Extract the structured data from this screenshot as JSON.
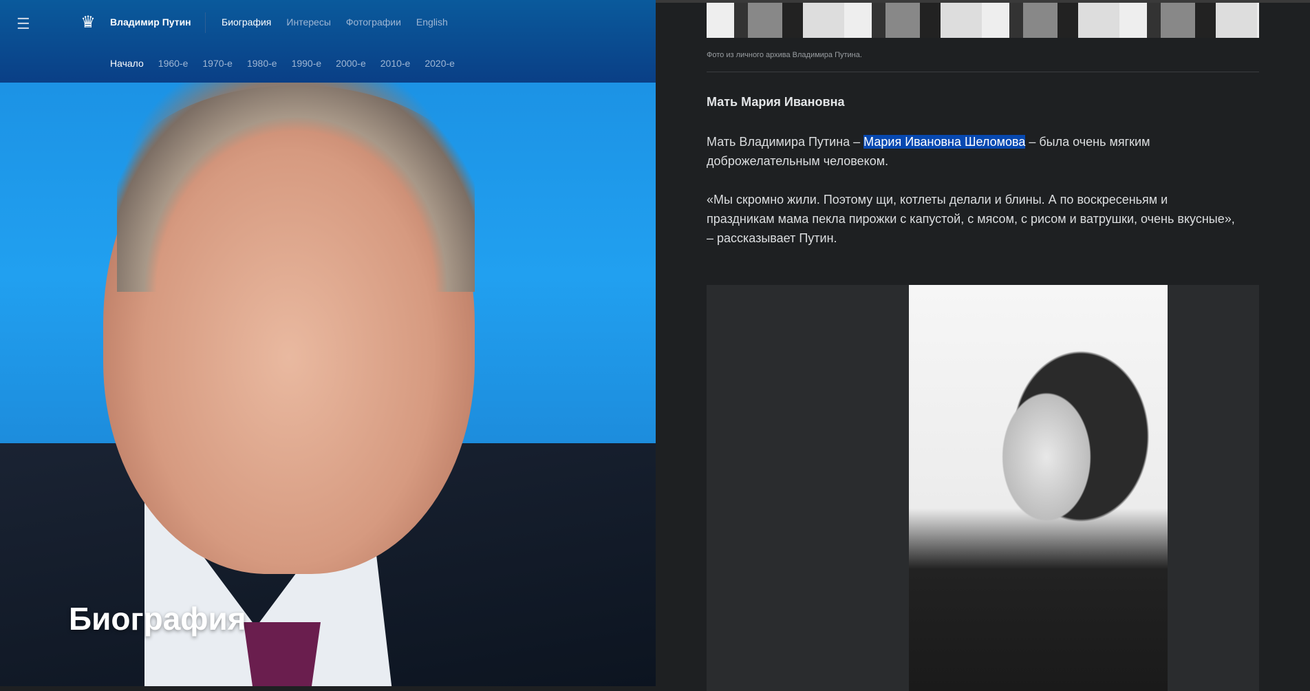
{
  "header": {
    "menu_icon": "hamburger-icon",
    "emblem_icon": "double-headed-eagle-icon",
    "brand": "Владимир Путин",
    "nav": [
      {
        "label": "Биография",
        "active": true
      },
      {
        "label": "Интересы"
      },
      {
        "label": "Фотографии"
      },
      {
        "label": "English"
      }
    ],
    "decades": [
      {
        "label": "Начало",
        "active": true
      },
      {
        "label": "1960-е"
      },
      {
        "label": "1970-е"
      },
      {
        "label": "1980-е"
      },
      {
        "label": "1990-е"
      },
      {
        "label": "2000-е"
      },
      {
        "label": "2010-е"
      },
      {
        "label": "2020-е"
      }
    ]
  },
  "hero": {
    "title": "Биография"
  },
  "article": {
    "caption": "Фото из личного архива Владимира Путина.",
    "heading": "Мать Мария Ивановна",
    "p1_before": "Мать Владимира Путина – ",
    "p1_highlight": "Мария Ивановна Шеломова",
    "p1_after": " – была очень мягким доброжелательным человеком.",
    "p2": "«Мы скромно жили. Поэтому щи, котлеты делали и блины. А по воскресеньям и праздникам мама пекла пирожки с капустой, с мясом, с рисом и ватрушки, очень вкусные», – рассказывает Путин."
  },
  "colors": {
    "highlight": "#0748b0",
    "header": "#0a4a8e",
    "background": "#1e2022"
  }
}
